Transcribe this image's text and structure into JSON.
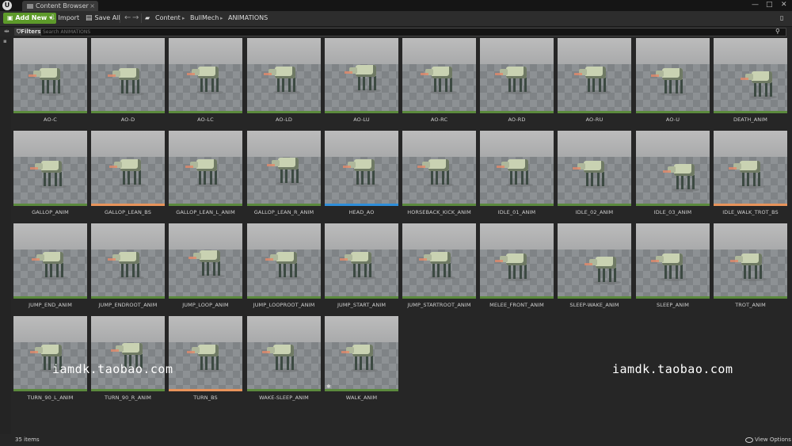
{
  "window": {
    "tab_title": "Content Browser",
    "logo_text": "U",
    "minimize": "—",
    "maximize": "□",
    "close": "✕"
  },
  "toolbar": {
    "add_new_label": "Add New",
    "import_label": "Import",
    "save_all_label": "Save All",
    "back_icon": "←",
    "forward_icon": "→",
    "breadcrumb": [
      "Content",
      "BullMech",
      "ANIMATIONS"
    ]
  },
  "filter_bar": {
    "filters_label": "Filters",
    "search_placeholder": "Search ANIMATIONS"
  },
  "colors": {
    "anim_sequence": "#5b8a3d",
    "blend_space": "#e8935a",
    "aim_offset": "#2e8ed9",
    "add_new": "#5d9a2a"
  },
  "assets": [
    {
      "name": "AO-C",
      "type": "anim"
    },
    {
      "name": "AO-D",
      "type": "anim"
    },
    {
      "name": "AO-LC",
      "type": "anim"
    },
    {
      "name": "AO-LD",
      "type": "anim"
    },
    {
      "name": "AO-LU",
      "type": "anim"
    },
    {
      "name": "AO-RC",
      "type": "anim"
    },
    {
      "name": "AO-RD",
      "type": "anim"
    },
    {
      "name": "AO-RU",
      "type": "anim"
    },
    {
      "name": "AO-U",
      "type": "anim"
    },
    {
      "name": "DEATH_ANIM",
      "type": "anim"
    },
    {
      "name": "GALLOP_ANIM",
      "type": "anim"
    },
    {
      "name": "GALLOP_LEAN_BS",
      "type": "blend"
    },
    {
      "name": "GALLOP_LEAN_L_ANIM",
      "type": "anim"
    },
    {
      "name": "GALLOP_LEAN_R_ANIM",
      "type": "anim"
    },
    {
      "name": "HEAD_AO",
      "type": "aimoffset"
    },
    {
      "name": "HORSEBACK_KICK_ANIM",
      "type": "anim"
    },
    {
      "name": "IDLE_01_ANIM",
      "type": "anim"
    },
    {
      "name": "IDLE_02_ANIM",
      "type": "anim"
    },
    {
      "name": "IDLE_03_ANIM",
      "type": "anim"
    },
    {
      "name": "IDLE_WALK_TROT_BS",
      "type": "blend"
    },
    {
      "name": "JUMP_END_ANIM",
      "type": "anim"
    },
    {
      "name": "JUMP_ENDROOT_ANIM",
      "type": "anim"
    },
    {
      "name": "JUMP_LOOP_ANIM",
      "type": "anim"
    },
    {
      "name": "JUMP_LOOPROOT_ANIM",
      "type": "anim"
    },
    {
      "name": "JUMP_START_ANIM",
      "type": "anim"
    },
    {
      "name": "JUMP_STARTROOT_ANIM",
      "type": "anim"
    },
    {
      "name": "MELEE_FRONT_ANIM",
      "type": "anim"
    },
    {
      "name": "SLEEP-WAKE_ANIM",
      "type": "anim"
    },
    {
      "name": "SLEEP_ANIM",
      "type": "anim"
    },
    {
      "name": "TROT_ANIM",
      "type": "anim"
    },
    {
      "name": "TURN_90_L_ANIM",
      "type": "anim"
    },
    {
      "name": "TURN_90_R_ANIM",
      "type": "anim"
    },
    {
      "name": "TURN_BS",
      "type": "blend"
    },
    {
      "name": "WAKE-SLEEP_ANIM",
      "type": "anim"
    },
    {
      "name": "WALK_ANIM",
      "type": "anim",
      "starred": true
    }
  ],
  "watermarks": [
    "iamdk.taobao.com",
    "iamdk.taobao.com"
  ],
  "status": {
    "item_count": "35 items",
    "view_options_label": "View Options"
  }
}
